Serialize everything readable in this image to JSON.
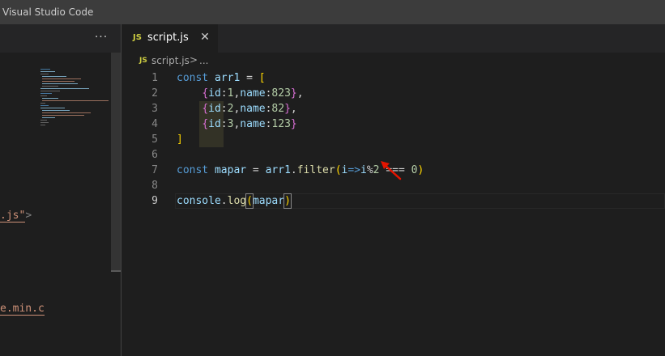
{
  "window": {
    "title": "Visual Studio Code"
  },
  "left_editor": {
    "more_actions_label": "···",
    "visible_fragments": [
      {
        "text": ".js\"",
        "punct": ">"
      },
      {
        "text": "e.min.c",
        "punct": ""
      }
    ]
  },
  "tab": {
    "icon_text": "JS",
    "label": "script.js",
    "close_label": "✕"
  },
  "breadcrumb": {
    "icon_text": "JS",
    "file": "script.js",
    "separator": ">",
    "more": "..."
  },
  "editor": {
    "line_numbers": [
      "1",
      "2",
      "3",
      "4",
      "5",
      "6",
      "7",
      "8",
      "9"
    ],
    "lines": [
      [
        {
          "t": "const ",
          "c": "kw"
        },
        {
          "t": "arr1",
          "c": "var"
        },
        {
          "t": " = ",
          "c": "op"
        },
        {
          "t": "[",
          "c": "b1"
        }
      ],
      [
        {
          "t": "    ",
          "c": "op"
        },
        {
          "t": "{",
          "c": "b2"
        },
        {
          "t": "id",
          "c": "var"
        },
        {
          "t": ":",
          "c": "op"
        },
        {
          "t": "1",
          "c": "num"
        },
        {
          "t": ",",
          "c": "op"
        },
        {
          "t": "name",
          "c": "var"
        },
        {
          "t": ":",
          "c": "op"
        },
        {
          "t": "823",
          "c": "num"
        },
        {
          "t": "}",
          "c": "b2"
        },
        {
          "t": ",",
          "c": "op"
        }
      ],
      [
        {
          "t": "    ",
          "c": "op"
        },
        {
          "t": "{",
          "c": "b2"
        },
        {
          "t": "id",
          "c": "var"
        },
        {
          "t": ":",
          "c": "op"
        },
        {
          "t": "2",
          "c": "num"
        },
        {
          "t": ",",
          "c": "op"
        },
        {
          "t": "name",
          "c": "var"
        },
        {
          "t": ":",
          "c": "op"
        },
        {
          "t": "82",
          "c": "num"
        },
        {
          "t": "}",
          "c": "b2"
        },
        {
          "t": ",",
          "c": "op"
        }
      ],
      [
        {
          "t": "    ",
          "c": "op"
        },
        {
          "t": "{",
          "c": "b2"
        },
        {
          "t": "id",
          "c": "var"
        },
        {
          "t": ":",
          "c": "op"
        },
        {
          "t": "3",
          "c": "num"
        },
        {
          "t": ",",
          "c": "op"
        },
        {
          "t": "name",
          "c": "var"
        },
        {
          "t": ":",
          "c": "op"
        },
        {
          "t": "123",
          "c": "num"
        },
        {
          "t": "}",
          "c": "b2"
        }
      ],
      [
        {
          "t": "]",
          "c": "b1"
        }
      ],
      [],
      [
        {
          "t": "const ",
          "c": "kw"
        },
        {
          "t": "mapar",
          "c": "var"
        },
        {
          "t": " = ",
          "c": "op"
        },
        {
          "t": "arr1",
          "c": "var"
        },
        {
          "t": ".",
          "c": "op"
        },
        {
          "t": "filter",
          "c": "fn"
        },
        {
          "t": "(",
          "c": "b1"
        },
        {
          "t": "i",
          "c": "var"
        },
        {
          "t": "=>",
          "c": "kw"
        },
        {
          "t": "i",
          "c": "var"
        },
        {
          "t": "%",
          "c": "op"
        },
        {
          "t": "2",
          "c": "num"
        },
        {
          "t": " === ",
          "c": "op"
        },
        {
          "t": "0",
          "c": "num"
        },
        {
          "t": ")",
          "c": "b1"
        }
      ],
      [],
      [
        {
          "t": "console",
          "c": "var"
        },
        {
          "t": ".",
          "c": "op"
        },
        {
          "t": "log",
          "c": "fn"
        },
        {
          "t": "(",
          "c": "b1"
        },
        {
          "t": "mapar",
          "c": "var"
        },
        {
          "t": ")",
          "c": "b1"
        }
      ]
    ],
    "active_line": 9
  },
  "colors": {
    "background": "#1e1e1e",
    "titlebar": "#3c3c3c",
    "tabbar": "#252526",
    "js_icon": "#cbcb41",
    "annotation_arrow": "#e51400"
  },
  "icons": {
    "more_actions": "ellipsis-icon",
    "tab_close": "close-icon",
    "file_type": "javascript-file-icon",
    "breadcrumb_separator": "chevron-right-icon",
    "annotation": "red-arrow-icon"
  }
}
